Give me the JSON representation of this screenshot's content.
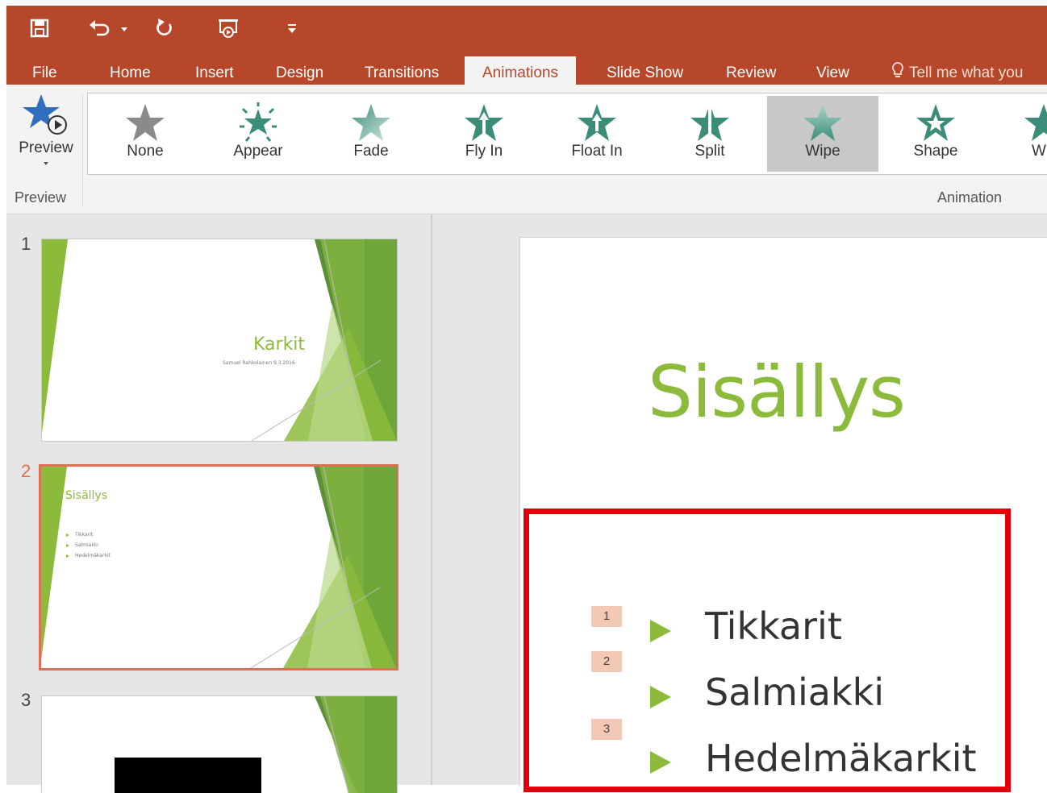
{
  "quick_access": {
    "icons": [
      "save-icon",
      "undo-icon",
      "undo-dropdown-icon",
      "redo-icon",
      "present-from-start-icon",
      "customize-qat-icon"
    ]
  },
  "tabs": [
    {
      "label": "File"
    },
    {
      "label": "Home"
    },
    {
      "label": "Insert"
    },
    {
      "label": "Design"
    },
    {
      "label": "Transitions"
    },
    {
      "label": "Animations",
      "active": true
    },
    {
      "label": "Slide Show"
    },
    {
      "label": "Review"
    },
    {
      "label": "View"
    }
  ],
  "tell_me": {
    "text": "Tell me what you",
    "icon": "lightbulb-icon"
  },
  "ribbon": {
    "preview": {
      "label": "Preview",
      "group_label": "Preview"
    },
    "animation_group_label": "Animation",
    "animations": [
      {
        "label": "None",
        "icon": "none-star-icon"
      },
      {
        "label": "Appear",
        "icon": "appear-star-icon"
      },
      {
        "label": "Fade",
        "icon": "fade-star-icon"
      },
      {
        "label": "Fly In",
        "icon": "fly-in-star-icon"
      },
      {
        "label": "Float In",
        "icon": "float-in-star-icon"
      },
      {
        "label": "Split",
        "icon": "split-star-icon"
      },
      {
        "label": "Wipe",
        "icon": "wipe-star-icon",
        "selected": true
      },
      {
        "label": "Shape",
        "icon": "shape-star-icon"
      },
      {
        "label": "W",
        "icon": "wheel-star-icon"
      }
    ]
  },
  "slides": [
    {
      "number": "1",
      "title": "Karkit",
      "subtitle": "Samuel Rahkolainen 9.3.2016"
    },
    {
      "number": "2",
      "title": "Sisällys",
      "bullets": [
        "Tikkarit",
        "Salmiakki",
        "Hedelmäkarkit"
      ],
      "selected": true
    },
    {
      "number": "3"
    }
  ],
  "main_slide": {
    "title": "Sisällys",
    "items": [
      {
        "tag": "1",
        "text": "Tikkarit"
      },
      {
        "tag": "2",
        "text": "Salmiakki"
      },
      {
        "tag": "3",
        "text": "Hedelmäkarkit"
      }
    ]
  },
  "colors": {
    "accent": "#b7472a",
    "green": "#8cbb3c",
    "selection_red": "#e0000b",
    "thumb_selected": "#e06e52"
  }
}
